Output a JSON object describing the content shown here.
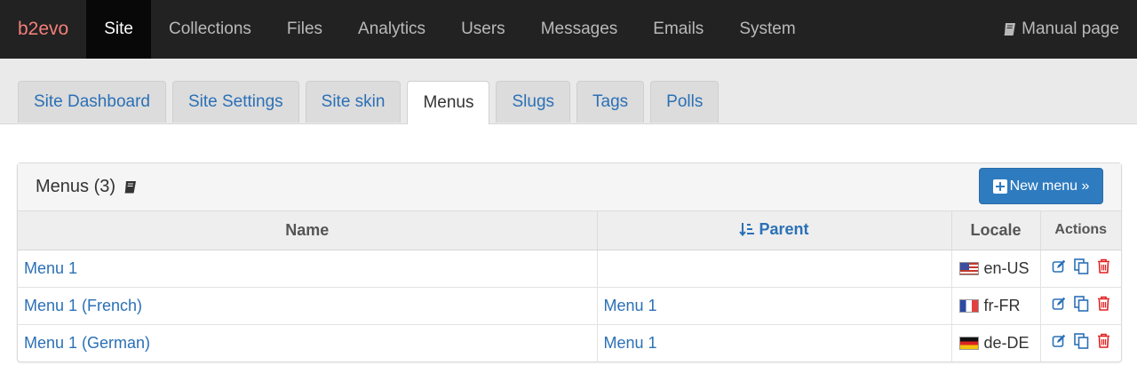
{
  "navbar": {
    "brand": "b2evo",
    "items": [
      {
        "label": "Site",
        "active": true
      },
      {
        "label": "Collections"
      },
      {
        "label": "Files"
      },
      {
        "label": "Analytics"
      },
      {
        "label": "Users"
      },
      {
        "label": "Messages"
      },
      {
        "label": "Emails"
      },
      {
        "label": "System"
      }
    ],
    "manual_label": "Manual page",
    "manual_icon": "book-icon"
  },
  "tabs": [
    {
      "label": "Site Dashboard"
    },
    {
      "label": "Site Settings"
    },
    {
      "label": "Site skin"
    },
    {
      "label": "Menus",
      "active": true
    },
    {
      "label": "Slugs"
    },
    {
      "label": "Tags"
    },
    {
      "label": "Polls"
    }
  ],
  "panel": {
    "title": "Menus (3)",
    "new_button_label": "New menu »",
    "columns": {
      "name": "Name",
      "parent": "Parent",
      "locale": "Locale",
      "actions": "Actions"
    },
    "rows": [
      {
        "name": "Menu 1",
        "parent": "",
        "locale": "en-US",
        "flag": "us"
      },
      {
        "name": "Menu 1 (French)",
        "parent": "Menu 1",
        "locale": "fr-FR",
        "flag": "fr"
      },
      {
        "name": "Menu 1 (German)",
        "parent": "Menu 1",
        "locale": "de-DE",
        "flag": "de"
      }
    ]
  },
  "colors": {
    "navbar_bg": "#222222",
    "brand": "#f47f79",
    "link": "#2b70b6",
    "primary_button": "#2f7bbf",
    "delete_icon": "#e02020"
  }
}
